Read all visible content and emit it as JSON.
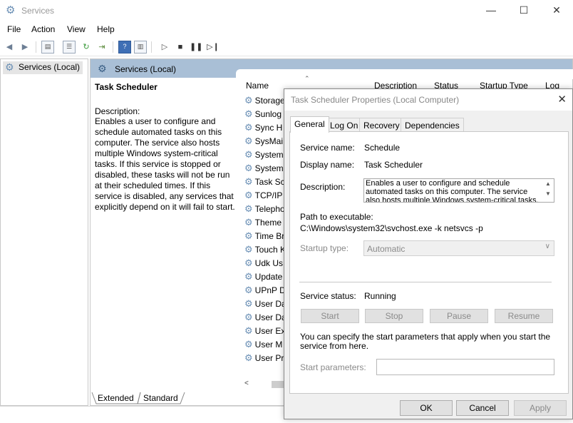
{
  "window": {
    "title": "Services",
    "controls": {
      "minimize": "—",
      "maximize": "☐",
      "close": "✕"
    }
  },
  "menu": [
    "File",
    "Action",
    "View",
    "Help"
  ],
  "toolbar": {
    "icons": [
      "back-arrow-icon",
      "forward-arrow-icon",
      "show-hide-tree-icon",
      "properties-icon",
      "refresh-icon",
      "export-list-icon",
      "help-icon",
      "show-hide-action-pane-icon",
      "play-icon",
      "stop-icon",
      "pause-icon",
      "restart-icon"
    ]
  },
  "tree": {
    "root": "Services (Local)"
  },
  "panel": {
    "header": "Services (Local)",
    "selected_service": "Task Scheduler",
    "description_label": "Description:",
    "description": "Enables a user to configure and schedule automated tasks on this computer. The service also hosts multiple Windows system-critical tasks. If this service is stopped or disabled, these tasks will not be run at their scheduled times. If this service is disabled, any services that explicitly depend on it will fail to start.",
    "columns": [
      "Name",
      "Description",
      "Status",
      "Startup Type",
      "Log"
    ],
    "services": [
      "Storage",
      "Sunlog",
      "Sync H",
      "SysMai",
      "System",
      "System",
      "Task Sc",
      "TCP/IP",
      "Telepho",
      "Theme",
      "Time Br",
      "Touch K",
      "Udk Us",
      "Update",
      "UPnP D",
      "User Da",
      "User Da",
      "User Ex",
      "User M",
      "User Pr"
    ],
    "bottom_tabs": [
      "Extended",
      "Standard"
    ]
  },
  "dialog": {
    "title": "Task Scheduler Properties (Local Computer)",
    "tabs": [
      "General",
      "Log On",
      "Recovery",
      "Dependencies"
    ],
    "service_name_label": "Service name:",
    "service_name": "Schedule",
    "display_name_label": "Display name:",
    "display_name": "Task Scheduler",
    "description_label": "Description:",
    "description": "Enables a user to configure and schedule automated tasks on this computer. The service also hosts multiple Windows system-critical tasks. If this",
    "path_label": "Path to executable:",
    "path": "C:\\Windows\\system32\\svchost.exe -k netsvcs -p",
    "startup_type_label": "Startup type:",
    "startup_type": "Automatic",
    "service_status_label": "Service status:",
    "service_status": "Running",
    "service_buttons": [
      "Start",
      "Stop",
      "Pause",
      "Resume"
    ],
    "start_params_note": "You can specify the start parameters that apply when you start the service from here.",
    "start_params_label": "Start parameters:",
    "start_params_value": "",
    "buttons": {
      "ok": "OK",
      "cancel": "Cancel",
      "apply": "Apply"
    }
  }
}
